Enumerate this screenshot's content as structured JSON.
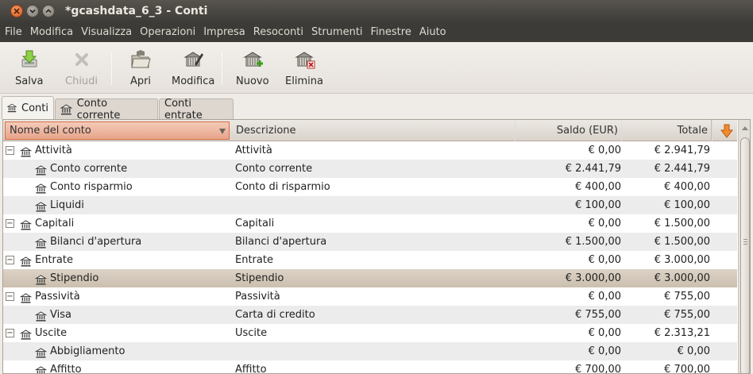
{
  "window": {
    "title": "*gcashdata_6_3 - Conti"
  },
  "menubar": [
    "File",
    "Modifica",
    "Visualizza",
    "Operazioni",
    "Impresa",
    "Resoconti",
    "Strumenti",
    "Finestre",
    "Aiuto"
  ],
  "toolbar": {
    "save": "Salva",
    "close": "Chiudi",
    "open": "Apri",
    "edit": "Modifica",
    "new": "Nuovo",
    "delete": "Elimina"
  },
  "tabs": [
    "Conti",
    "Conto corrente",
    "Conti entrate"
  ],
  "table": {
    "columns": [
      "Nome del conto",
      "Descrizione",
      "Saldo (EUR)",
      "Totale"
    ],
    "rows": [
      {
        "name": "Attività",
        "desc": "Attività",
        "saldo": "€ 0,00",
        "totale": "€ 2.941,79",
        "level": 0
      },
      {
        "name": "Conto corrente",
        "desc": "Conto corrente",
        "saldo": "€ 2.441,79",
        "totale": "€ 2.441,79",
        "level": 1
      },
      {
        "name": "Conto risparmio",
        "desc": "Conto di risparmio",
        "saldo": "€ 400,00",
        "totale": "€ 400,00",
        "level": 1
      },
      {
        "name": "Liquidi",
        "desc": "",
        "saldo": "€ 100,00",
        "totale": "€ 100,00",
        "level": 1
      },
      {
        "name": "Capitali",
        "desc": "Capitali",
        "saldo": "€ 0,00",
        "totale": "€ 1.500,00",
        "level": 0
      },
      {
        "name": "Bilanci d'apertura",
        "desc": "Bilanci d'apertura",
        "saldo": "€ 1.500,00",
        "totale": "€ 1.500,00",
        "level": 1
      },
      {
        "name": "Entrate",
        "desc": "Entrate",
        "saldo": "€ 0,00",
        "totale": "€ 3.000,00",
        "level": 0
      },
      {
        "name": "Stipendio",
        "desc": "Stipendio",
        "saldo": "€ 3.000,00",
        "totale": "€ 3.000,00",
        "level": 1,
        "selected": true
      },
      {
        "name": "Passività",
        "desc": "Passività",
        "saldo": "€ 0,00",
        "totale": "€ 755,00",
        "level": 0
      },
      {
        "name": "Visa",
        "desc": "Carta di credito",
        "saldo": "€ 755,00",
        "totale": "€ 755,00",
        "level": 1
      },
      {
        "name": "Uscite",
        "desc": "Uscite",
        "saldo": "€ 0,00",
        "totale": "€ 2.313,21",
        "level": 0
      },
      {
        "name": "Abbigliamento",
        "desc": "",
        "saldo": "€ 0,00",
        "totale": "€ 0,00",
        "level": 1
      },
      {
        "name": "Affitto",
        "desc": "Affitto",
        "saldo": "€ 700,00",
        "totale": "€ 700,00",
        "level": 1
      }
    ]
  },
  "colors": {
    "titlebar": "#3d3b37",
    "selected_row": "#cbbfae",
    "sorted_header": "#e7a48a"
  }
}
